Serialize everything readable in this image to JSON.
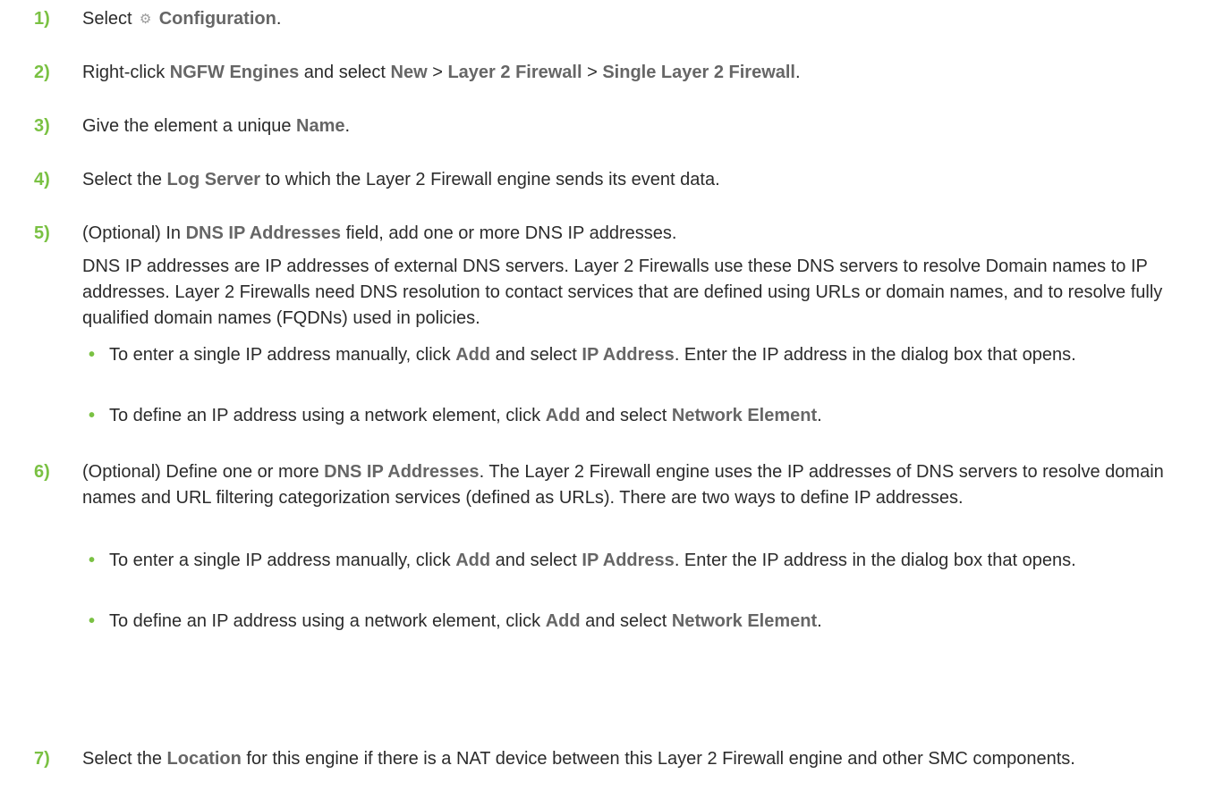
{
  "steps": [
    {
      "num": "1)",
      "parts": [
        "Select ",
        "Configuration",
        "."
      ],
      "icon": "gears-icon"
    },
    {
      "num": "2)",
      "parts": [
        "Right-click ",
        "NGFW Engines",
        " and select ",
        "New",
        " > ",
        "Layer 2 Firewall",
        " > ",
        "Single Layer 2 Firewall",
        "."
      ]
    },
    {
      "num": "3)",
      "parts": [
        "Give the element a unique ",
        "Name",
        "."
      ]
    },
    {
      "num": "4)",
      "parts": [
        "Select the ",
        "Log Server",
        " to which the Layer 2 Firewall engine sends its event data."
      ]
    },
    {
      "num": "5)",
      "parts": [
        "(Optional) In ",
        "DNS IP Addresses",
        " field, add one or more DNS IP addresses."
      ],
      "para": "DNS IP addresses are IP addresses of external DNS servers. Layer 2 Firewalls use these DNS servers to resolve Domain names to IP addresses. Layer 2 Firewalls need DNS resolution to contact services that are defined using URLs or domain names, and to resolve fully qualified domain names (FQDNs) used in policies.",
      "bullets": [
        [
          "To enter a single IP address manually, click ",
          "Add",
          " and select ",
          "IP Address",
          ". Enter the IP address in the dialog box that opens."
        ],
        [
          "To define an IP address using a network element, click ",
          "Add",
          " and select ",
          "Network Element",
          "."
        ]
      ]
    },
    {
      "num": "6)",
      "parts": [
        "(Optional) Define one or more ",
        "DNS IP Addresses",
        ". The Layer 2 Firewall engine uses the IP addresses of DNS servers to resolve domain names and URL filtering categorization services (defined as URLs). There are two ways to define IP addresses."
      ],
      "bullets": [
        [
          "To enter a single IP address manually, click ",
          "Add",
          " and select ",
          "IP Address",
          ". Enter the IP address in the dialog box that opens."
        ],
        [
          "To define an IP address using a network element, click ",
          "Add",
          " and select ",
          "Network Element",
          "."
        ]
      ]
    },
    {
      "num": "7)",
      "parts": [
        "Select the ",
        "Location",
        " for this engine if there is a NAT device between this Layer 2 Firewall engine and other SMC components."
      ]
    }
  ],
  "bullet_char": "•",
  "gear_glyph": "⚙",
  "colors": {
    "step_number": "#7ac143",
    "ui_term": "#666666",
    "body_text": "#2b2b2b"
  }
}
